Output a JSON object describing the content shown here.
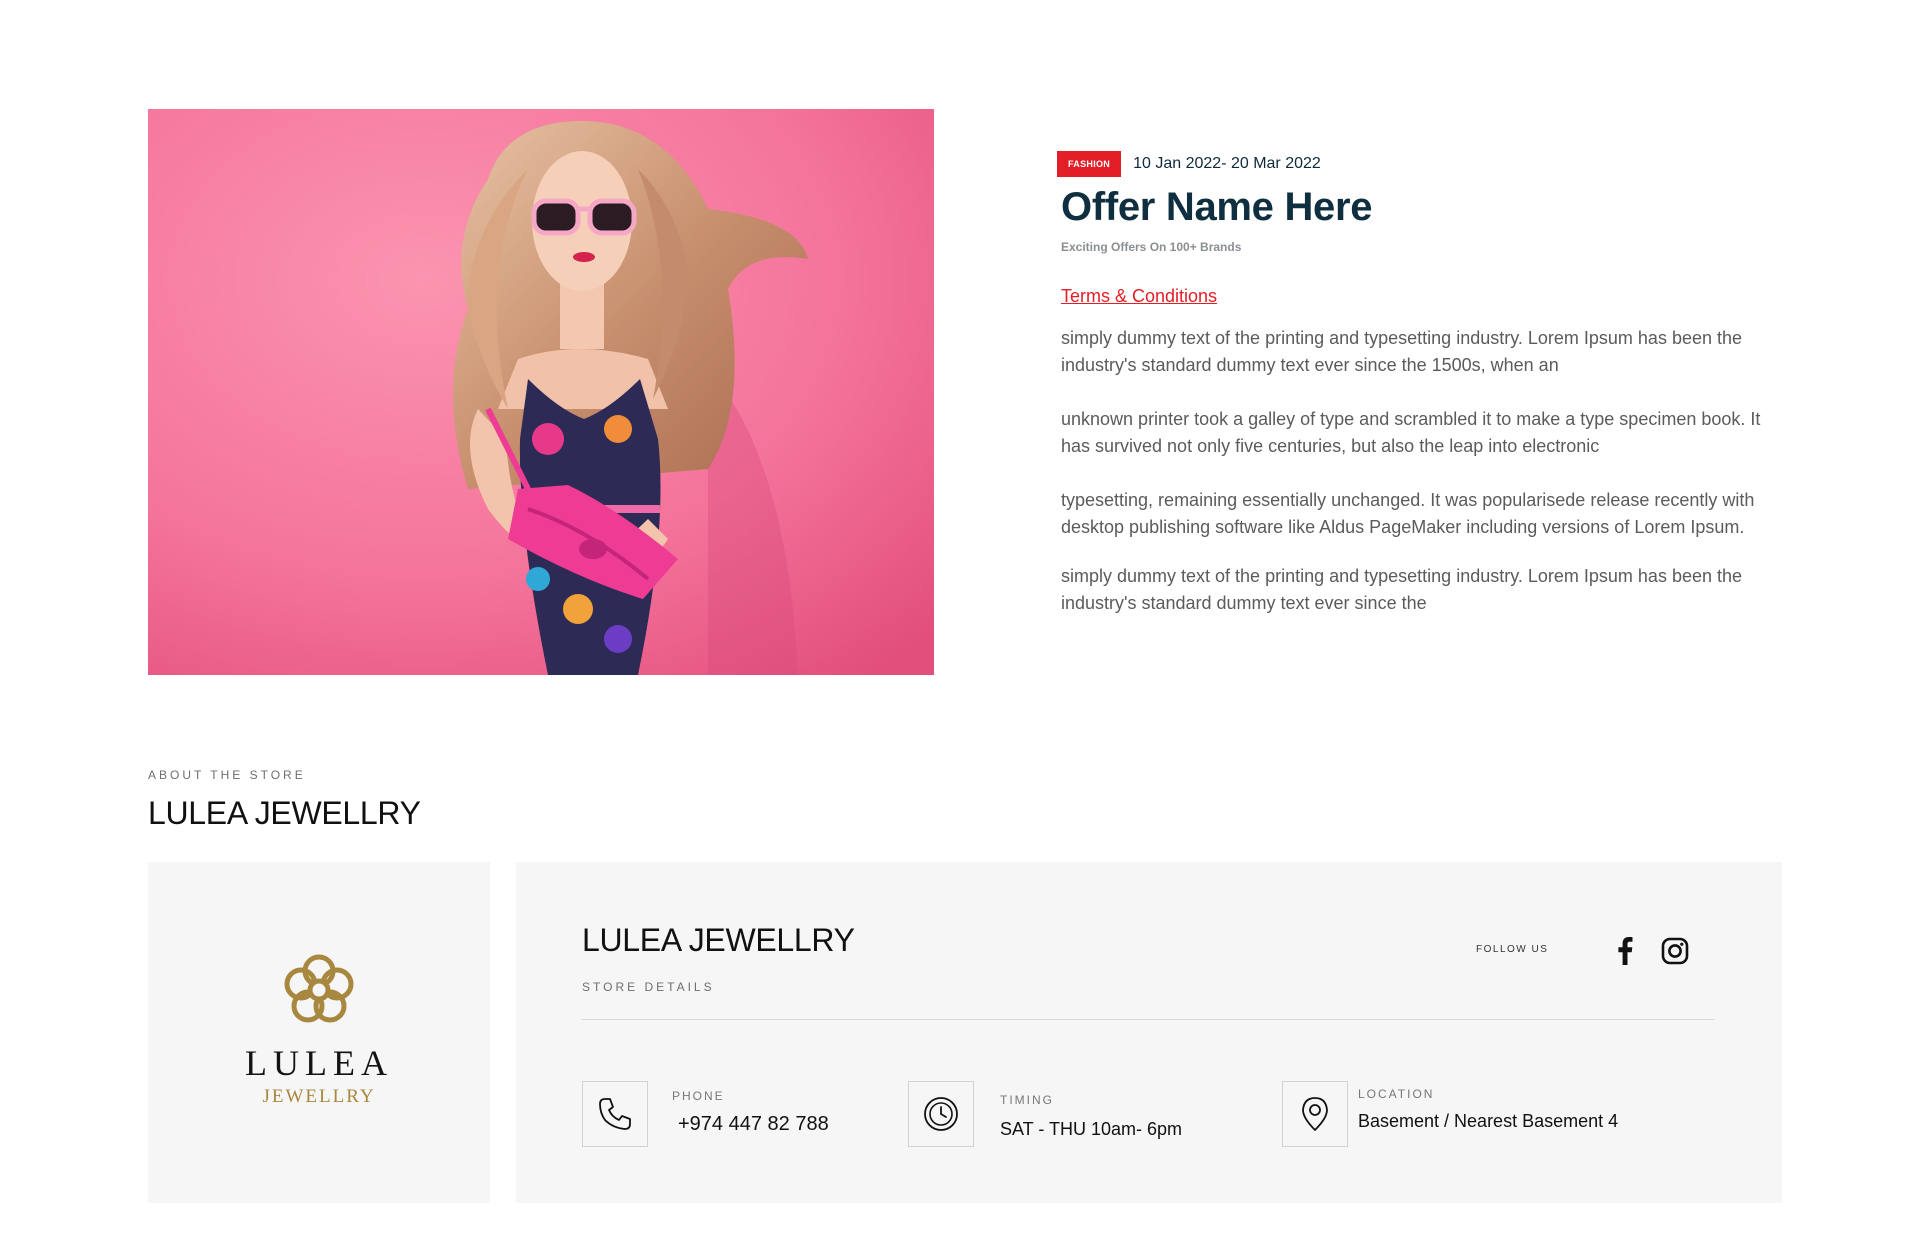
{
  "offer": {
    "badge": "FASHION",
    "date_range": "10 Jan 2022- 20 Mar 2022",
    "title": "Offer Name Here",
    "subtitle": "Exciting Offers On 100+ Brands",
    "terms_link": "Terms & Conditions",
    "paragraphs": [
      "simply dummy text of the printing and typesetting industry. Lorem Ipsum has been the industry's standard dummy text ever since the 1500s, when an",
      "unknown printer took a galley of type and scrambled it to make a type specimen book. It has survived not only five centuries, but also the leap into electronic",
      "typesetting, remaining essentially unchanged. It was popularisede release recently with desktop publishing software like Aldus PageMaker including versions of Lorem Ipsum.",
      "simply dummy text of the printing and typesetting industry. Lorem Ipsum has been the industry's standard dummy text ever since the"
    ],
    "image_icon": "fashion-model-photo"
  },
  "about": {
    "label": "ABOUT THE STORE",
    "title": "LULEA JEWELLRY"
  },
  "logo": {
    "name": "LULEA",
    "sub": "JEWELLRY",
    "icon": "flower-logo-icon",
    "gold_color": "#a8873f"
  },
  "store": {
    "name": "LULEA JEWELLRY",
    "details_label": "STORE DETAILS",
    "follow_label": "FOLLOW US",
    "social_icons": [
      "facebook-icon",
      "instagram-icon"
    ],
    "phone": {
      "label": "PHONE",
      "value": "+974 447 82 788",
      "icon": "phone-icon"
    },
    "timing": {
      "label": "TIMING",
      "value": "SAT - THU  10am- 6pm",
      "icon": "clock-icon"
    },
    "location": {
      "label": "LOCATION",
      "value": "Basement / Nearest Basement 4",
      "icon": "location-pin-icon"
    }
  },
  "colors": {
    "accent_red": "#e21e26",
    "title_navy": "#0f2e3f",
    "card_bg": "#f6f6f6",
    "hero_pink": "#f26f96"
  }
}
